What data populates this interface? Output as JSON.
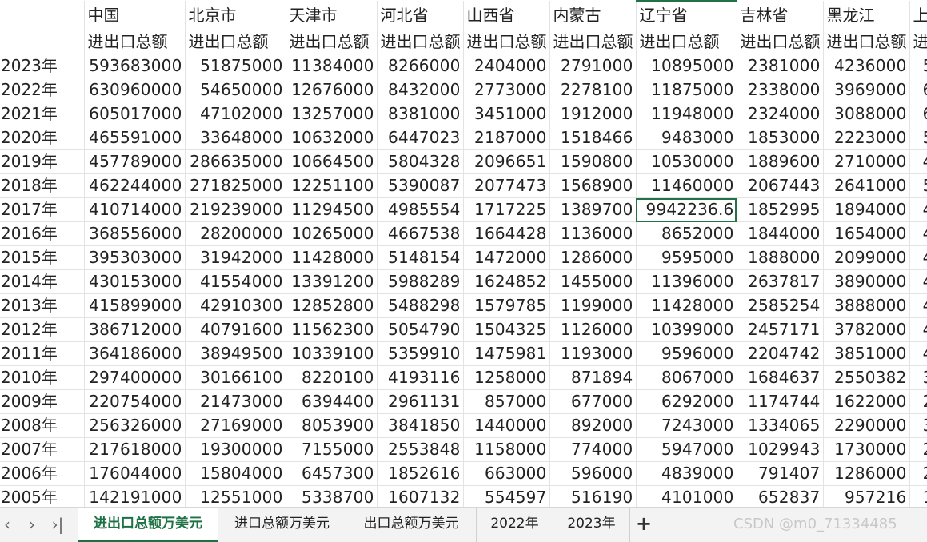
{
  "columns": [
    "中国",
    "北京市",
    "天津市",
    "河北省",
    "山西省",
    "内蒙古",
    "辽宁省",
    "吉林省",
    "黑龙江",
    "上"
  ],
  "subheaders": [
    "进出口总额",
    "进出口总额",
    "进出口总额",
    "进出口总额",
    "进出口总额",
    "进出口总额",
    "进出口总额",
    "进出口总额",
    "进出口总额",
    "进出口总额"
  ],
  "rows": [
    {
      "year": "2023年",
      "values": [
        "593683000",
        "51875000",
        "11384000",
        "8266000",
        "2404000",
        "2791000",
        "10895000",
        "2381000",
        "4236000",
        "5"
      ]
    },
    {
      "year": "2022年",
      "values": [
        "630960000",
        "54650000",
        "12676000",
        "8432000",
        "2773000",
        "2278100",
        "11875000",
        "2338000",
        "3969000",
        "6"
      ]
    },
    {
      "year": "2021年",
      "values": [
        "605017000",
        "47102000",
        "13257000",
        "8381000",
        "3451000",
        "1912000",
        "11948000",
        "2324000",
        "3088000",
        "6"
      ]
    },
    {
      "year": "2020年",
      "values": [
        "465591000",
        "33648000",
        "10632000",
        "6447023",
        "2187000",
        "1518466",
        "9483000",
        "1853000",
        "2223000",
        "5"
      ]
    },
    {
      "year": "2019年",
      "values": [
        "457789000",
        "286635000",
        "10664500",
        "5804328",
        "2096651",
        "1590800",
        "10530000",
        "1889600",
        "2710000",
        "4"
      ]
    },
    {
      "year": "2018年",
      "values": [
        "462244000",
        "271825000",
        "12251100",
        "5390087",
        "2077473",
        "1568900",
        "11460000",
        "2067443",
        "2641000",
        "5"
      ]
    },
    {
      "year": "2017年",
      "values": [
        "410714000",
        "219239000",
        "11294500",
        "4985554",
        "1717225",
        "1389700",
        "9942236.6",
        "1852995",
        "1894000",
        "4"
      ]
    },
    {
      "year": "2016年",
      "values": [
        "368556000",
        "28200000",
        "10265000",
        "4667538",
        "1664428",
        "1136000",
        "8652000",
        "1844000",
        "1654000",
        "4"
      ]
    },
    {
      "year": "2015年",
      "values": [
        "395303000",
        "31942000",
        "11428000",
        "5148154",
        "1472000",
        "1286000",
        "9595000",
        "1888000",
        "2099000",
        "4"
      ]
    },
    {
      "year": "2014年",
      "values": [
        "430153000",
        "41554000",
        "13391200",
        "5988289",
        "1624852",
        "1455000",
        "11396000",
        "2637817",
        "3890000",
        "4"
      ]
    },
    {
      "year": "2013年",
      "values": [
        "415899000",
        "42910300",
        "12852800",
        "5488298",
        "1579785",
        "1199000",
        "11428000",
        "2585254",
        "3888000",
        "4"
      ]
    },
    {
      "year": "2012年",
      "values": [
        "386712000",
        "40791600",
        "11562300",
        "5054790",
        "1504325",
        "1126000",
        "10399000",
        "2457171",
        "3782000",
        "4"
      ]
    },
    {
      "year": "2011年",
      "values": [
        "364186000",
        "38949500",
        "10339100",
        "5359910",
        "1475981",
        "1193000",
        "9596000",
        "2204742",
        "3851000",
        "4"
      ]
    },
    {
      "year": "2010年",
      "values": [
        "297400000",
        "30166100",
        "8220100",
        "4193116",
        "1258000",
        "871894",
        "8067000",
        "1684637",
        "2550382",
        "3"
      ]
    },
    {
      "year": "2009年",
      "values": [
        "220754000",
        "21473000",
        "6394400",
        "2961131",
        "857000",
        "677000",
        "6292000",
        "1174744",
        "1622000",
        "2"
      ]
    },
    {
      "year": "2008年",
      "values": [
        "256326000",
        "27169000",
        "8053900",
        "3841850",
        "1440000",
        "892000",
        "7243000",
        "1334065",
        "2290000",
        "3"
      ]
    },
    {
      "year": "2007年",
      "values": [
        "217618000",
        "19300000",
        "7155000",
        "2553848",
        "1158000",
        "774000",
        "5947000",
        "1029943",
        "1730000",
        "2"
      ]
    },
    {
      "year": "2006年",
      "values": [
        "176044000",
        "15804000",
        "6457300",
        "1852616",
        "663000",
        "596000",
        "4839000",
        "791407",
        "1286000",
        "2"
      ]
    },
    {
      "year": "2005年",
      "values": [
        "142191000",
        "12551000",
        "5338700",
        "1607132",
        "554597",
        "516190",
        "4101000",
        "652837",
        "957216",
        "1"
      ]
    }
  ],
  "selected": {
    "row": 6,
    "col": 6
  },
  "tabs": [
    "进出口总额万美元",
    "进口总额万美元",
    "出口总额万美元",
    "2022年",
    "2023年"
  ],
  "active_tab": 0,
  "nav": {
    "prev": "‹",
    "next": "›",
    "last": "›|"
  },
  "add_sheet_label": "+",
  "watermark": "CSDN @m0_71334485",
  "colors": {
    "accent": "#217346",
    "grid": "#e3e3e3",
    "tab_active_text": "#1e7145"
  }
}
